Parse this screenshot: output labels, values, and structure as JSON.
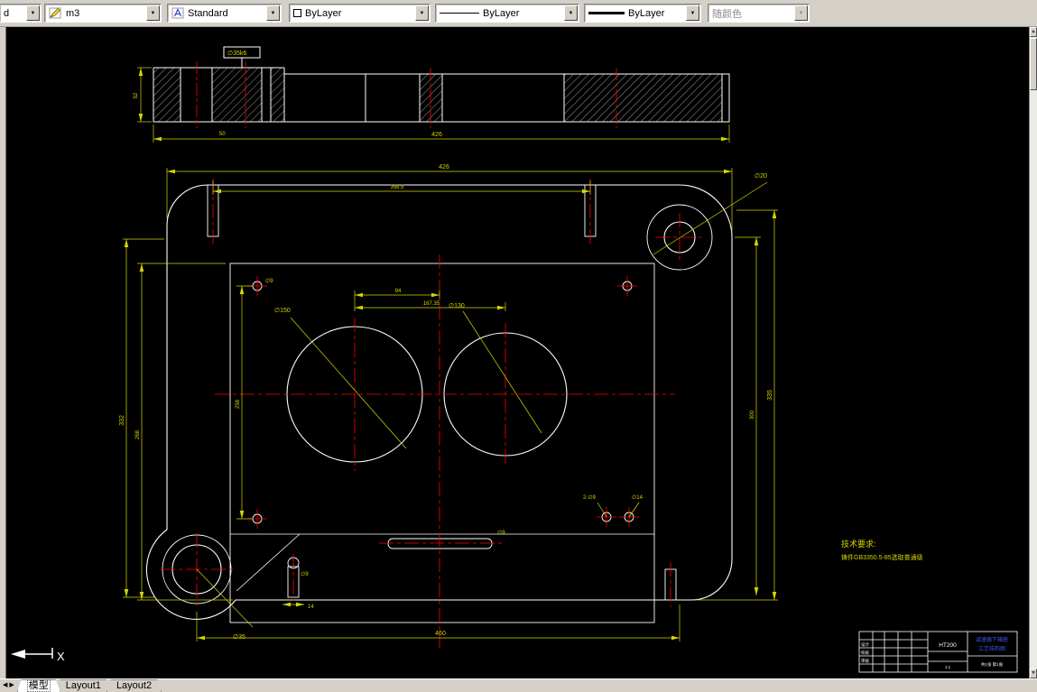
{
  "icons": {
    "chevron_down": "▼",
    "scroll_up": "▲",
    "scroll_down": "▼",
    "tab_prev": "◀",
    "tab_next": "▶"
  },
  "toolbar": {
    "partial_combo": {
      "value": "d"
    },
    "layer_combo": {
      "value": "m3"
    },
    "style_combo": {
      "value": "Standard"
    },
    "color_combo": {
      "value": "ByLayer"
    },
    "linetype_combo": {
      "value": "ByLayer"
    },
    "lineweight_combo": {
      "value": "ByLayer"
    },
    "plotstyle_combo": {
      "value": "随颜色"
    }
  },
  "tabs": {
    "model": "模型",
    "layout1": "Layout1",
    "layout2": "Layout2"
  },
  "drawing": {
    "dims": {
      "section_width": "426",
      "section_offset": "50",
      "section_height": "52",
      "section_callout": "∅35k6",
      "overall_width": "426",
      "boss_spacing": "358.5",
      "left_height": "332",
      "left_inner_height": "268",
      "right_height": "335",
      "right_inner_height": "300",
      "bottom_span": "460",
      "center_half": "94",
      "center_dist": "167.35",
      "left_holes_span": "258",
      "left_bore": "∅150",
      "right_bore": "∅130",
      "corner_hole_tr": "∅20",
      "corner_hole_bl": "∅35",
      "small_hole_label": "∅9",
      "pair_hole_label": "2-∅9",
      "sink_hole_label": "∅14",
      "slot_label": "∅9",
      "boss_width": "14",
      "boss_hole": "∅9"
    },
    "tech_req": {
      "title": "技术要求:",
      "line1": "铸件GB3350.5-85选取普通级"
    },
    "ucs": {
      "x_label": "X"
    },
    "title_block": {
      "material": "HT200",
      "part_line1": "减速器下箱座",
      "part_line2": "工艺结构图",
      "designer_label": "设计",
      "checker_label": "校核",
      "auditor_label": "审核",
      "scale": "1:1",
      "sheet": "共1张 第1张"
    }
  },
  "colors": {
    "background": "#000000",
    "geometry": "#ffffff",
    "centerline": "#ff0000",
    "dimension": "#d6d600",
    "part_name_text": "#3a55e8",
    "toolbar_bg": "#d4d0c8"
  }
}
